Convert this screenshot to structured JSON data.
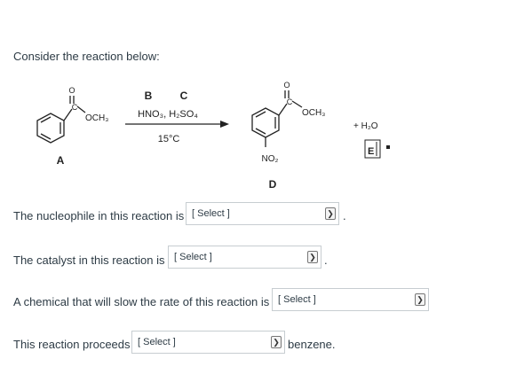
{
  "intro": "Consider the reaction below:",
  "scheme": {
    "label_b": "B",
    "label_c": "C",
    "reagents": "HNO₃, H₂SO₄",
    "temperature": "15°C",
    "reactant_group": "OCH₃",
    "reactant_carbonyl_o": "O",
    "reactant_carbon": "C",
    "label_a": "A",
    "product_group": "OCH₃",
    "product_carbonyl_o": "O",
    "product_carbon": "C",
    "product_nitro": "NO₂",
    "label_d": "D",
    "byproduct": "+ H₂O",
    "label_e": "E"
  },
  "questions": [
    {
      "prefix": "The nucleophile in this reaction is",
      "select": "[ Select ]",
      "suffix": "."
    },
    {
      "prefix": "The catalyst in this reaction is",
      "select": "[ Select ]",
      "suffix": "."
    },
    {
      "prefix": "A chemical that will slow the rate of this reaction is",
      "select": "[ Select ]",
      "suffix": ""
    },
    {
      "prefix": "This reaction proceeds",
      "select": "[ Select ]",
      "suffix": "benzene."
    }
  ]
}
